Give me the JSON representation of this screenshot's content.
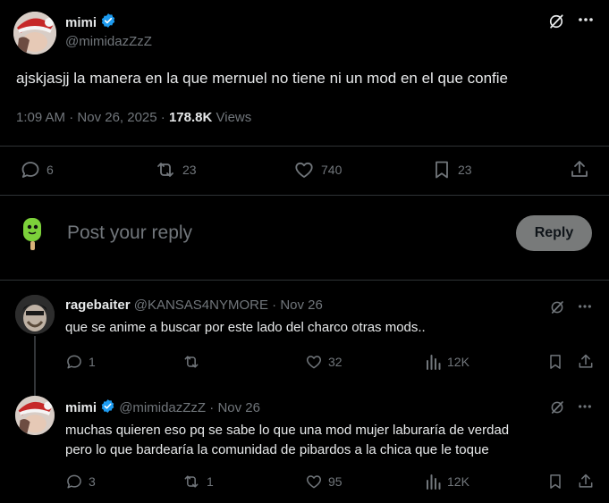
{
  "tweet": {
    "author_name": "mimi",
    "author_handle": "@mimidazZzZ",
    "text": "ajskjasjj la manera en la que mernuel no tiene ni un mod en el que confie",
    "time": "1:09 AM",
    "date": "Nov 26, 2025",
    "sep": "·",
    "views_count": "178.8K",
    "views_label": "Views",
    "replies": "6",
    "retweets": "23",
    "likes": "740",
    "bookmarks": "23",
    "icons": [
      "grok-icon",
      "more-icon",
      "reply-icon",
      "retweet-icon",
      "like-icon",
      "bookmark-icon",
      "share-icon"
    ]
  },
  "composer": {
    "placeholder": "Post your reply",
    "button_label": "Reply"
  },
  "replies": [
    {
      "author_name": "ragebaiter",
      "author_handle": "@KANSAS4NYMORE",
      "date": "Nov 26",
      "text": "que se anime a buscar por este lado del charco otras mods..",
      "replies": "1",
      "retweets": "",
      "likes": "32",
      "views": "12K"
    },
    {
      "author_name": "mimi",
      "author_handle": "@mimidazZzZ",
      "date": "Nov 26",
      "text_line1": "muchas quieren eso pq se sabe lo que una mod mujer laburaría de verdad",
      "text_line2": "pero lo que bardearía la comunidad de pibardos a la chica que le toque",
      "replies": "3",
      "retweets": "1",
      "likes": "95",
      "views": "12K"
    }
  ],
  "colors": {
    "background": "#000000",
    "text": "#e7e9ea",
    "muted": "#71767b",
    "verified": "#1d9bf0",
    "reply_button_bg": "#787a7a",
    "divider": "#2f3336"
  }
}
